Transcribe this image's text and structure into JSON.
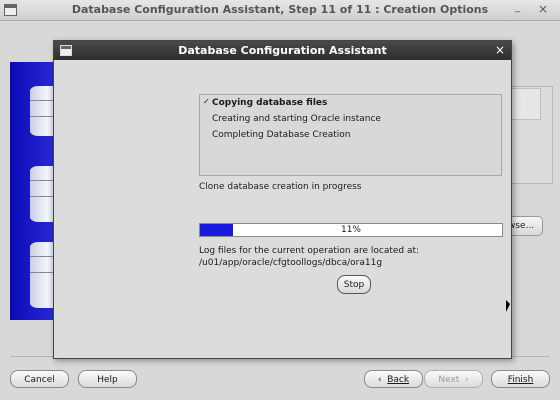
{
  "background_window": {
    "title": "Database Configuration Assistant, Step 11 of 11 : Creation Options",
    "minimize_glyph": "_",
    "close_glyph": "×",
    "browse_label": "wse...",
    "buttons": {
      "cancel": "Cancel",
      "help": "Help",
      "back": "Back",
      "next": "Next",
      "finish": "Finish"
    }
  },
  "dialog": {
    "title": "Database Configuration Assistant",
    "close_glyph": "×",
    "steps": [
      {
        "label": "Copying database files",
        "active": true,
        "check": "✓"
      },
      {
        "label": "Creating and starting Oracle instance",
        "active": false
      },
      {
        "label": "Completing Database Creation",
        "active": false
      }
    ],
    "status": "Clone database creation in progress",
    "progress": {
      "percent": 11,
      "label": "11%",
      "color": "#1818e0"
    },
    "log_label": "Log files for the current operation are located at:",
    "log_path": "/u01/app/oracle/cfgtoollogs/dbca/ora11g",
    "stop_label": "Stop"
  },
  "icons": [
    "window-menu-icon",
    "database-cylinder-icon",
    "checkmark-icon",
    "close-icon",
    "mouse-cursor-icon"
  ]
}
